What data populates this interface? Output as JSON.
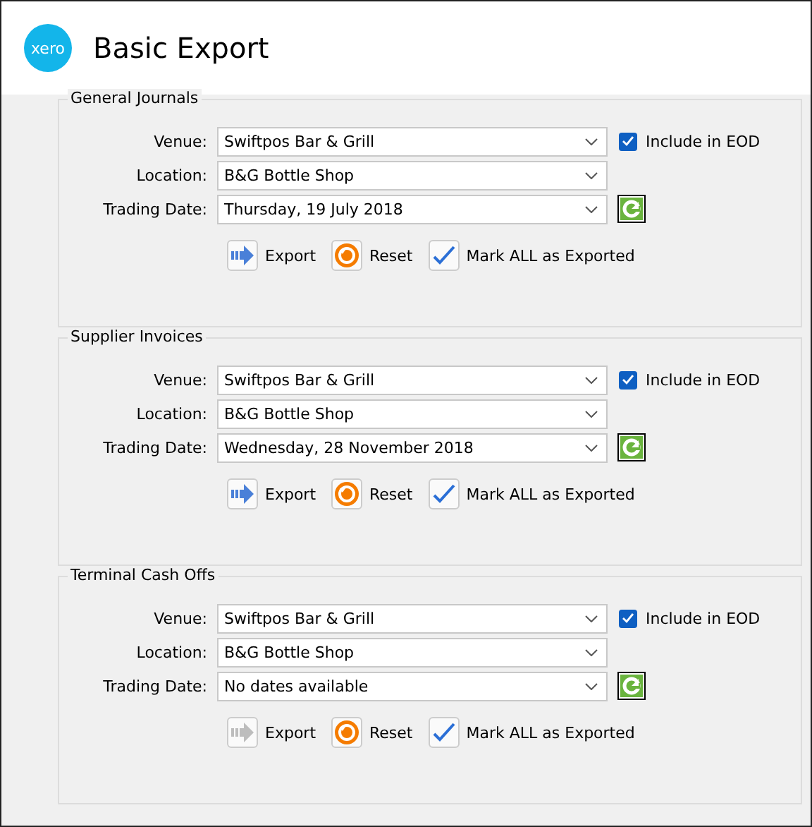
{
  "logo": "xero",
  "title": "Basic Export",
  "groups": [
    {
      "title": "General Journals",
      "venue_label": "Venue:",
      "venue": "Swiftpos Bar & Grill",
      "include": {
        "label": "Include in EOD",
        "checked": true
      },
      "location_label": "Location:",
      "location": "B&G Bottle Shop",
      "date_label": "Trading Date:",
      "date": "Thursday, 19 July 2018",
      "actions": [
        {
          "kind": "export",
          "label": "Export",
          "disabled": false
        },
        {
          "kind": "reset",
          "label": "Reset",
          "disabled": false
        },
        {
          "kind": "mark",
          "label": "Mark ALL as Exported",
          "disabled": false
        }
      ]
    },
    {
      "title": "Supplier Invoices",
      "venue_label": "Venue:",
      "venue": "Swiftpos Bar & Grill",
      "include": {
        "label": "Include in EOD",
        "checked": true
      },
      "location_label": "Location:",
      "location": "B&G Bottle Shop",
      "date_label": "Trading Date:",
      "date": "Wednesday, 28 November 2018",
      "actions": [
        {
          "kind": "export",
          "label": "Export",
          "disabled": false
        },
        {
          "kind": "reset",
          "label": "Reset",
          "disabled": false
        },
        {
          "kind": "mark",
          "label": "Mark ALL as Exported",
          "disabled": false
        }
      ]
    },
    {
      "title": "Terminal Cash Offs",
      "venue_label": "Venue:",
      "venue": "Swiftpos Bar & Grill",
      "include": {
        "label": "Include in EOD",
        "checked": true
      },
      "location_label": "Location:",
      "location": "B&G Bottle Shop",
      "date_label": "Trading Date:",
      "date": "No dates available",
      "actions": [
        {
          "kind": "export",
          "label": "Export",
          "disabled": true
        },
        {
          "kind": "reset",
          "label": "Reset",
          "disabled": false
        },
        {
          "kind": "mark",
          "label": "Mark ALL as Exported",
          "disabled": false
        }
      ]
    }
  ]
}
